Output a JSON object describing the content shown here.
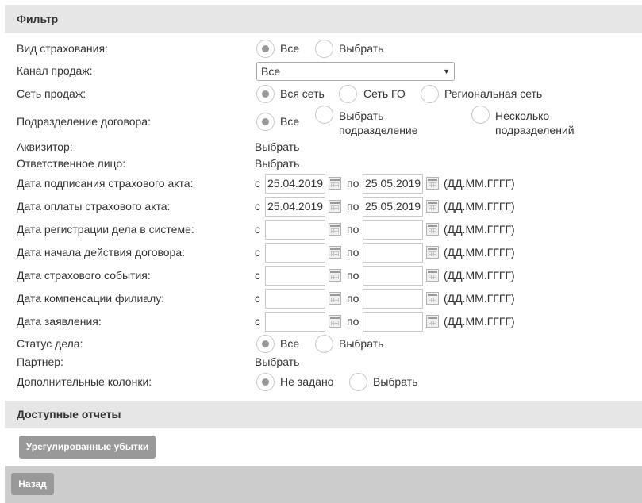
{
  "filter": {
    "title": "Фильтр",
    "fields": {
      "insurance_type": {
        "label": "Вид страхования:",
        "opt_all": "Все",
        "opt_select": "Выбрать"
      },
      "sales_channel": {
        "label": "Канал продаж:",
        "value": "Все"
      },
      "sales_network": {
        "label": "Сеть продаж:",
        "opt_all": "Вся сеть",
        "opt_go": "Сеть ГО",
        "opt_regional": "Региональная сеть"
      },
      "contract_division": {
        "label": "Подразделение договора:",
        "opt_all": "Все",
        "opt_select_line1": "Выбрать",
        "opt_select_line2": "подразделение",
        "opt_multi_line1": "Несколько",
        "opt_multi_line2": "подразделений"
      },
      "acquirer": {
        "label": "Аквизитор:",
        "link": "Выбрать"
      },
      "responsible": {
        "label": "Ответственное лицо:",
        "link": "Выбрать"
      },
      "act_signed": {
        "label": "Дата подписания страхового акта:",
        "from": "25.04.2019",
        "to": "25.05.2019"
      },
      "act_paid": {
        "label": "Дата оплаты страхового акта:",
        "from": "25.04.2019",
        "to": "25.05.2019"
      },
      "case_registered": {
        "label": "Дата регистрации дела в системе:",
        "from": "",
        "to": ""
      },
      "contract_start": {
        "label": "Дата начала действия договора:",
        "from": "",
        "to": ""
      },
      "insured_event": {
        "label": "Дата страхового события:",
        "from": "",
        "to": ""
      },
      "branch_compensation": {
        "label": "Дата компенсации филиалу:",
        "from": "",
        "to": ""
      },
      "application": {
        "label": "Дата заявления:",
        "from": "",
        "to": ""
      },
      "case_status": {
        "label": "Статус дела:",
        "opt_all": "Все",
        "opt_select": "Выбрать"
      },
      "partner": {
        "label": "Партнер:",
        "link": "Выбрать"
      },
      "extra_columns": {
        "label": "Дополнительные колонки:",
        "opt_none": "Не задано",
        "opt_select": "Выбрать"
      }
    },
    "date_from": "с",
    "date_to": "по",
    "date_format": "(ДД.ММ.ГГГГ)"
  },
  "reports": {
    "title": "Доступные отчеты",
    "button": "Урегулированные убытки"
  },
  "footer": {
    "back": "Назад"
  }
}
